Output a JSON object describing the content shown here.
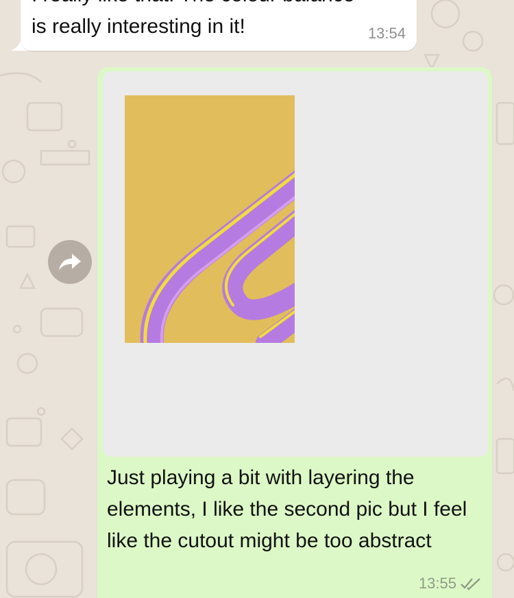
{
  "incoming_message": {
    "text_line1": "I really like that! The colour balance",
    "text_line2": "is really interesting in it!",
    "time": "13:54"
  },
  "outgoing_message": {
    "caption": "Just playing a bit with layering the elements, I like the second pic but I feel like the cutout might be too abstract",
    "time": "13:55",
    "status_icon": "double-check-icon"
  },
  "forward_button": {
    "icon": "forward-arrow-icon"
  },
  "colors": {
    "chat_background": "#e9e3da",
    "incoming_bubble": "#ffffff",
    "outgoing_bubble": "#dcf8c6",
    "image_background": "#e1bd5c",
    "image_tube": "#b57be0",
    "image_highlight": "#f2dc3c"
  }
}
